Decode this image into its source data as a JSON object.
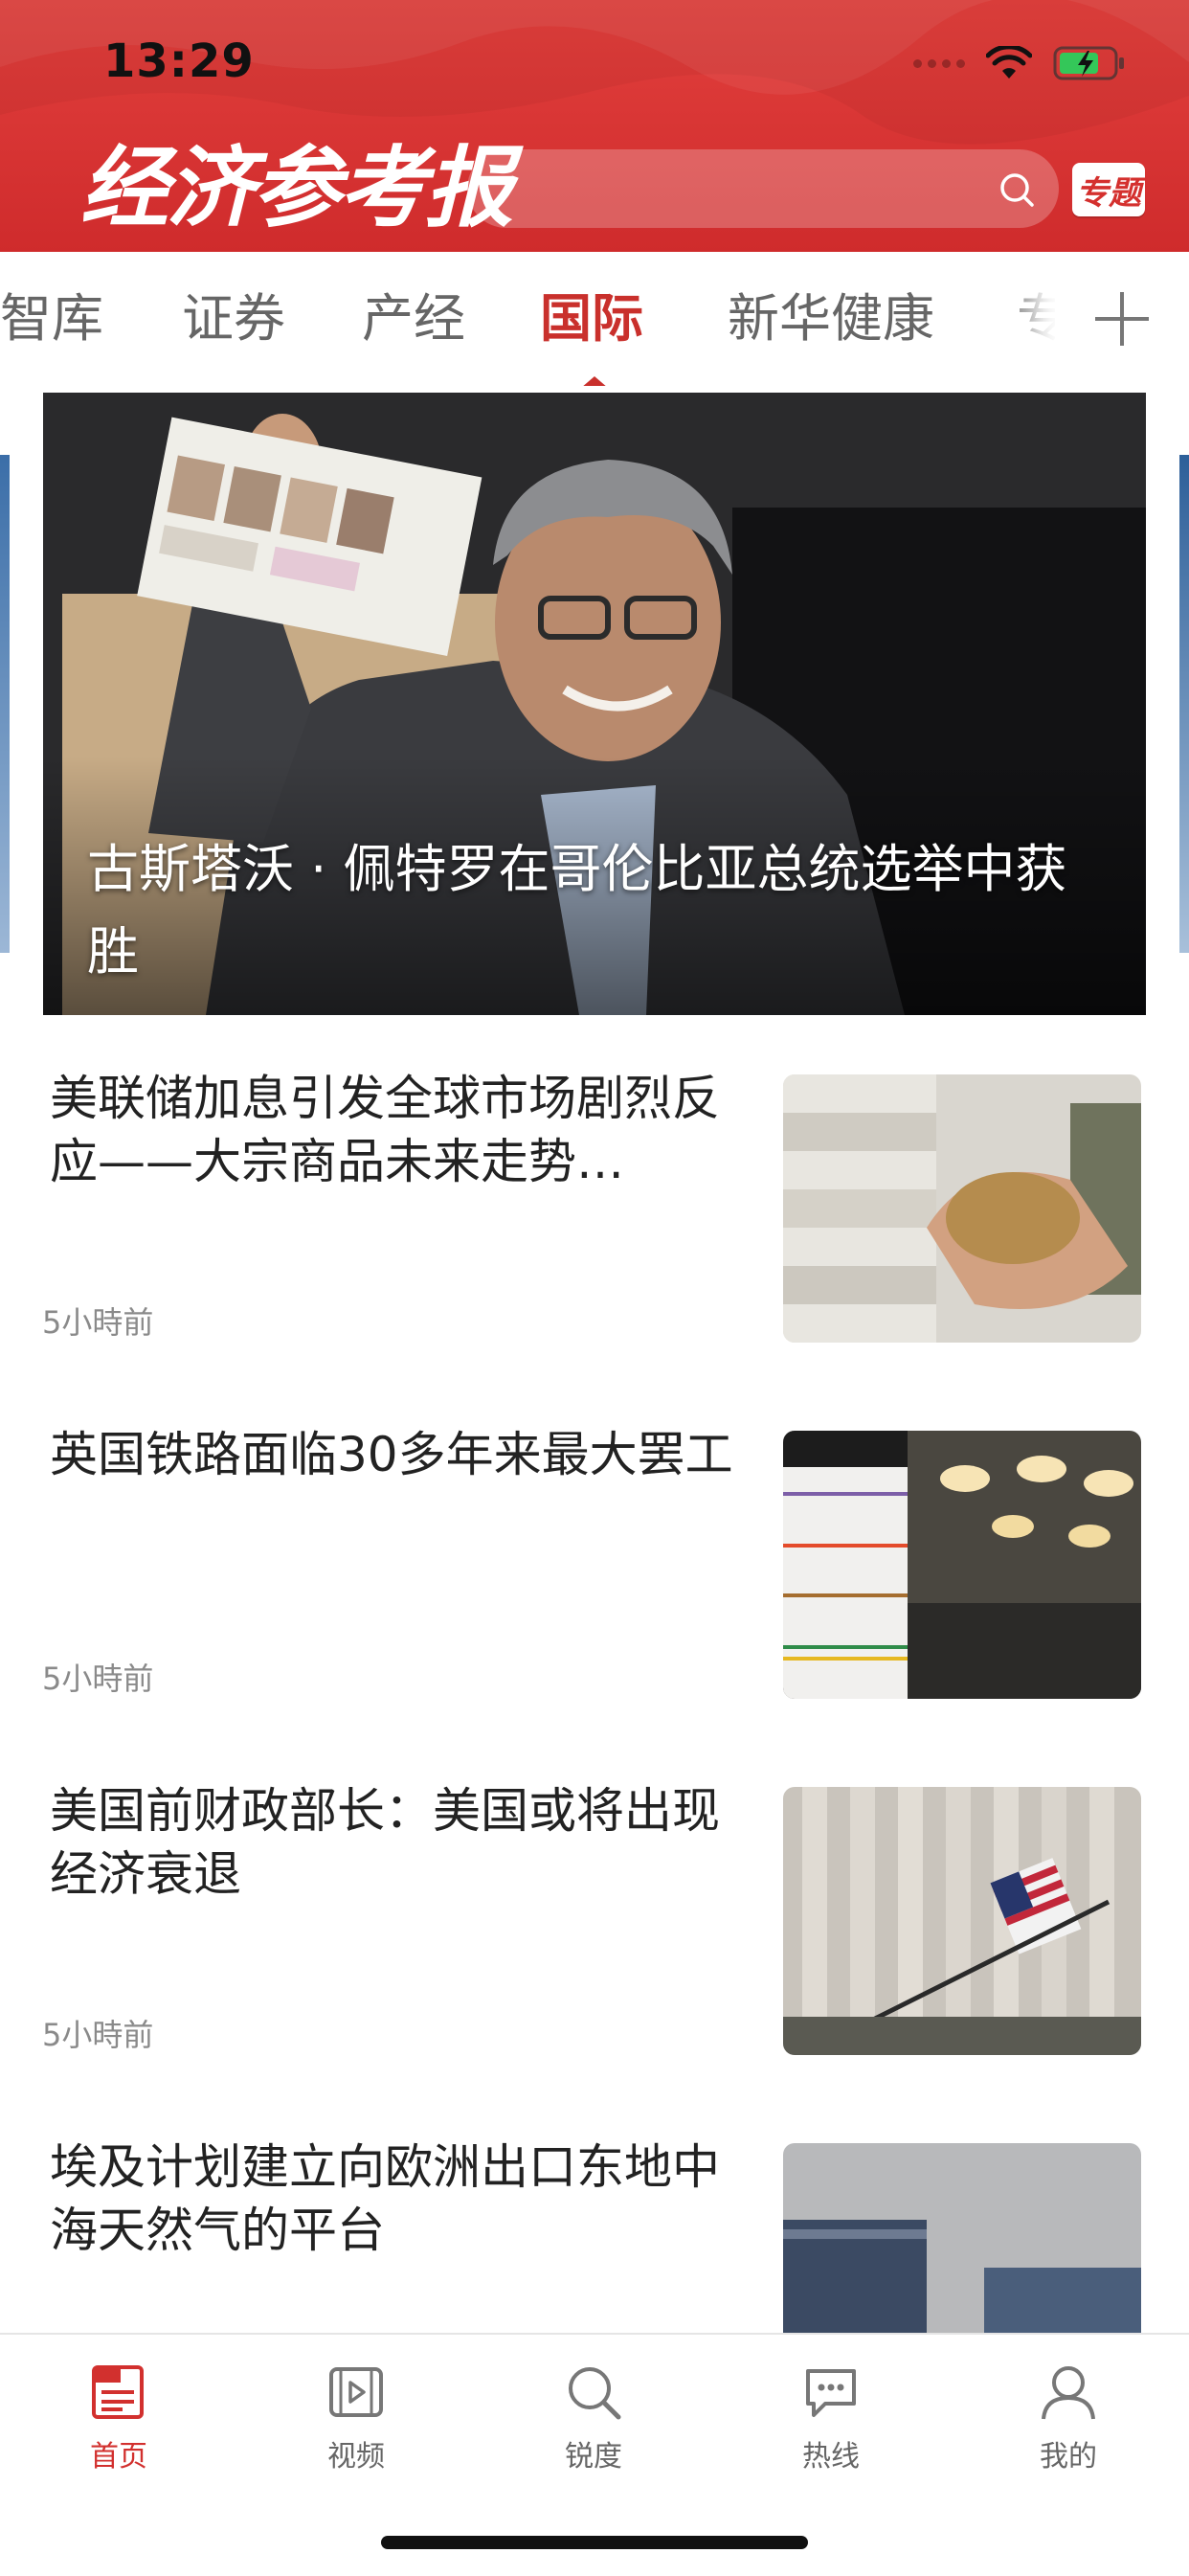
{
  "status_bar": {
    "time": "13:29"
  },
  "header": {
    "logo_text": "经济参考报",
    "search_placeholder": "",
    "topic_badge": "专题"
  },
  "channel_tabs": [
    {
      "label": "智库"
    },
    {
      "label": "证券"
    },
    {
      "label": "产经"
    },
    {
      "label": "国际",
      "active": true
    },
    {
      "label": "新华健康"
    },
    {
      "label": "专"
    }
  ],
  "hero": {
    "title": "古斯塔沃 · 佩特罗在哥伦比亚总统选举中获胜"
  },
  "news": [
    {
      "title": "美联储加息引发全球市场剧烈反应——大宗商品未来走势…",
      "time": "5小時前"
    },
    {
      "title": "英国铁路面临30多年来最大罢工",
      "time": "5小時前"
    },
    {
      "title": "美国前财政部长：美国或将出现经济衰退",
      "time": "5小時前"
    },
    {
      "title": "埃及计划建立向欧洲出口东地中海天然气的平台",
      "time": ""
    }
  ],
  "tab_bar": [
    {
      "label": "首页",
      "icon": "news-icon",
      "active": true
    },
    {
      "label": "视频",
      "icon": "video-icon"
    },
    {
      "label": "锐度",
      "icon": "search-icon"
    },
    {
      "label": "热线",
      "icon": "chat-icon"
    },
    {
      "label": "我的",
      "icon": "user-icon"
    }
  ],
  "colors": {
    "brand_red": "#d2302e",
    "header_red": "#d93632"
  }
}
